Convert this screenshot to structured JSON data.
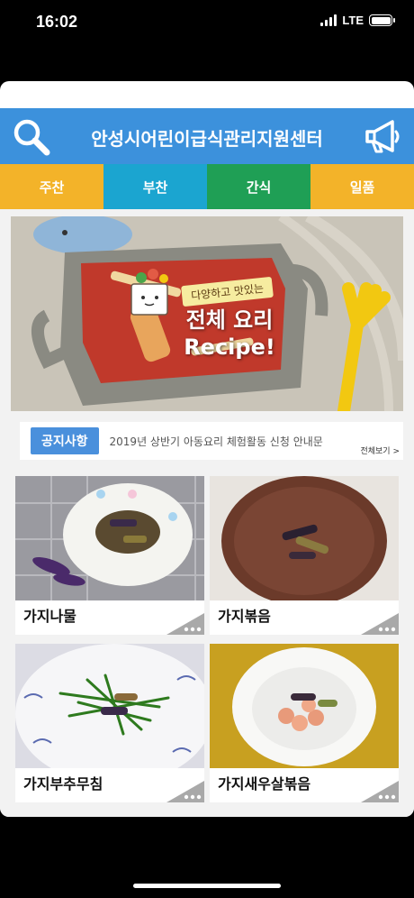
{
  "status": {
    "time": "16:02",
    "network": "LTE"
  },
  "header": {
    "title": "안성시어린이급식관리지원센터"
  },
  "tabs": [
    {
      "label": "주찬"
    },
    {
      "label": "부찬"
    },
    {
      "label": "간식"
    },
    {
      "label": "일품"
    }
  ],
  "banner": {
    "tag": "다양하고 맛있는",
    "title_line1": "전체 요리",
    "title_line2": "Recipe!"
  },
  "notice": {
    "label": "공지사항",
    "text": "2019년 상반기 아동요리 체험활동 신청 안내문",
    "more": "전체보기 >"
  },
  "recipes": [
    {
      "name": "가지나물"
    },
    {
      "name": "가지볶음"
    },
    {
      "name": "가지부추무침"
    },
    {
      "name": "가지새우살볶음"
    }
  ],
  "colors": {
    "header": "#3c91dc",
    "tab_main": "#f3b329",
    "tab_side": "#1ba5d0",
    "tab_snack": "#1f9f55",
    "tab_single": "#f3b329"
  }
}
